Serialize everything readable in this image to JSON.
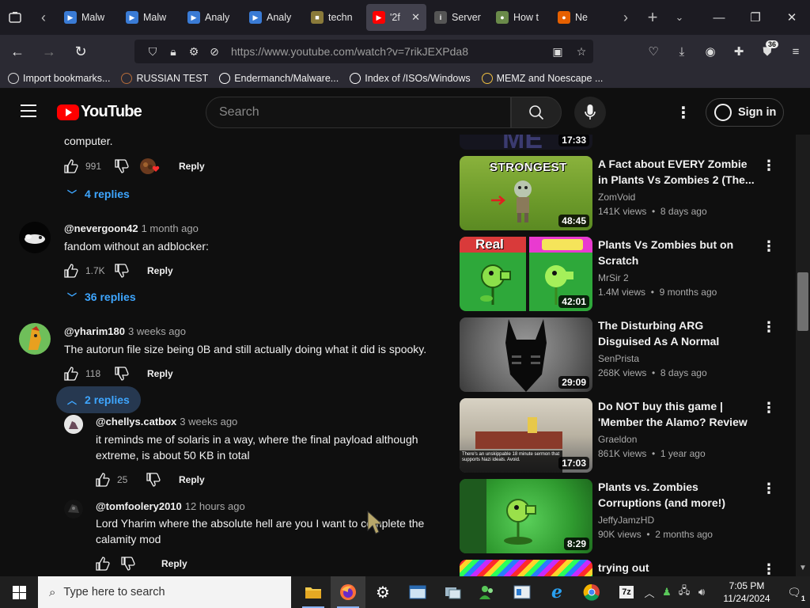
{
  "browser": {
    "tabs": [
      {
        "label": "Malw",
        "fav_color": "#3a7bd5",
        "fav_glyph": "▶"
      },
      {
        "label": "Malw",
        "fav_color": "#3a7bd5",
        "fav_glyph": "▶"
      },
      {
        "label": "Analy",
        "fav_color": "#3a7bd5",
        "fav_glyph": "▶"
      },
      {
        "label": "Analy",
        "fav_color": "#3a7bd5",
        "fav_glyph": "▶"
      },
      {
        "label": "techn",
        "fav_color": "#8a7a3a",
        "fav_glyph": "■"
      },
      {
        "label": "'2f",
        "fav_color": "#ff0000",
        "fav_glyph": "▶",
        "active": true
      },
      {
        "label": "Server",
        "fav_color": "#555555",
        "fav_glyph": "i"
      },
      {
        "label": "How t",
        "fav_color": "#6a8a4a",
        "fav_glyph": "●"
      },
      {
        "label": "Ne",
        "fav_color": "#e66000",
        "fav_glyph": "●"
      }
    ],
    "url": "https://www.youtube.com/watch?v=7rikJEXPda8",
    "extensions_badge": "36",
    "bookmarks": [
      {
        "label": "Import bookmarks...",
        "icon_color": "#dddddd"
      },
      {
        "label": "RUSSIAN TEST",
        "icon_color": "#b36b3a"
      },
      {
        "label": "Endermanch/Malware...",
        "icon_color": "#ffffff"
      },
      {
        "label": "Index of /ISOs/Windows",
        "icon_color": "#ffffff"
      },
      {
        "label": "MEMZ and Noescape ...",
        "icon_color": "#f0c040"
      }
    ]
  },
  "youtube": {
    "logo_text": "YouTube",
    "search_placeholder": "Search",
    "sign_in": "Sign in"
  },
  "comments": {
    "top_fragment": {
      "text": "computer.",
      "likes": "991",
      "reply": "Reply",
      "replies_toggle": "4 replies"
    },
    "items": [
      {
        "author": "@nevergoon42",
        "time": "1 month ago",
        "text": "fandom without an adblocker:",
        "likes": "1.7K",
        "reply": "Reply",
        "replies_toggle": "36 replies"
      },
      {
        "author": "@yharim180",
        "time": "3 weeks ago",
        "text": "The autorun file size being 0B and still actually doing what it did is spooky.",
        "likes": "118",
        "reply": "Reply",
        "replies_toggle": "2 replies"
      }
    ],
    "replies": [
      {
        "author": "@chellys.catbox",
        "time": "3 weeks ago",
        "text_line1": "it reminds me of solaris in a way, where the final payload although",
        "text_line2": "extreme, is about 50 KB in total",
        "likes": "25",
        "reply": "Reply"
      },
      {
        "author": "@tomfoolery2010",
        "time": "12 hours ago",
        "text_line1": "Lord Yharim where the absolute hell are you I want to complete the",
        "text_line2": "calamity mod",
        "likes": "",
        "reply": "Reply"
      }
    ]
  },
  "recommendations": [
    {
      "title": "",
      "channel": "",
      "meta": "",
      "duration": "17:33"
    },
    {
      "title": "A Fact about EVERY Zombie in Plants Vs Zombies 2 (The...",
      "channel": "ZomVoid",
      "views": "141K views",
      "age": "8 days ago",
      "duration": "48:45",
      "thumb_text": "STRONGEST"
    },
    {
      "title": "Plants Vs Zombies but on Scratch",
      "channel": "MrSir 2",
      "views": "1.4M views",
      "age": "9 months ago",
      "duration": "42:01",
      "thumb_text": "Real"
    },
    {
      "title": "The Disturbing ARG Disguised As A Normal Channel",
      "channel": "SenPrista",
      "views": "268K views",
      "age": "8 days ago",
      "duration": "29:09"
    },
    {
      "title": "Do NOT buy this game | 'Member the Alamo? Review",
      "channel": "Graeldon",
      "views": "861K views",
      "age": "1 year ago",
      "duration": "17:03",
      "thumb_text": "There's an unskippable 18 minute sermon that supports Nazi ideals. Avoid."
    },
    {
      "title": "Plants vs. Zombies Corruptions (and more!)",
      "channel": "JeffyJamzHD",
      "views": "90K views",
      "age": "2 months ago",
      "duration": "8:29"
    },
    {
      "title": "trying out Oxymorphazone.exe!",
      "channel": "",
      "views": "",
      "age": "",
      "duration": ""
    }
  ],
  "taskbar": {
    "search_placeholder": "Type here to search",
    "time": "7:05 PM",
    "date": "11/24/2024",
    "notifications": "1"
  }
}
